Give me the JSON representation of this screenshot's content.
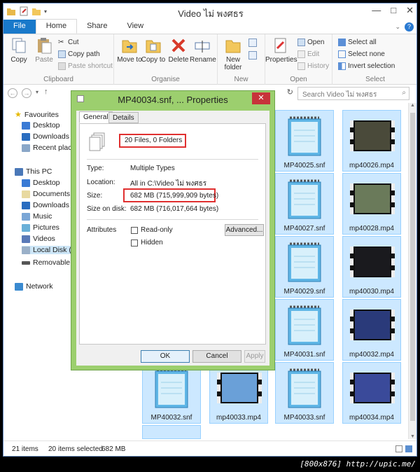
{
  "window": {
    "title": "Video ไม่ พงศธร",
    "controls": [
      "—",
      "□",
      "✕"
    ]
  },
  "ribbon_tabs": [
    "File",
    "Home",
    "Share",
    "View"
  ],
  "ribbon": {
    "clipboard": {
      "label": "Clipboard",
      "copy": "Copy",
      "paste": "Paste",
      "cut": "Cut",
      "copy_path": "Copy path",
      "paste_shortcut": "Paste shortcut"
    },
    "organise": {
      "label": "Organise",
      "move_to": "Move to",
      "copy_to": "Copy to",
      "delete": "Delete",
      "rename": "Rename"
    },
    "new": {
      "label": "New",
      "new_folder": "New folder"
    },
    "open": {
      "label": "Open",
      "properties": "Properties",
      "open": "Open",
      "edit": "Edit",
      "history": "History"
    },
    "select": {
      "label": "Select",
      "select_all": "Select all",
      "select_none": "Select none",
      "invert_selection": "Invert selection"
    }
  },
  "address": {
    "search_placeholder": "Search Video ไม่ พงศธร"
  },
  "nav": {
    "favourites": "Favourites",
    "fav_items": [
      "Desktop",
      "Downloads",
      "Recent places"
    ],
    "this_pc": "This PC",
    "pc_items": [
      "Desktop",
      "Documents",
      "Downloads",
      "Music",
      "Pictures",
      "Videos",
      "Local Disk (C:)",
      "Removable Disk"
    ],
    "network": "Network"
  },
  "files": [
    {
      "name": "MP40025.snf",
      "kind": "doc"
    },
    {
      "name": "mp40026.mp4",
      "kind": "video",
      "scene": "#4a4a3a"
    },
    {
      "name": "MP40027.snf",
      "kind": "doc"
    },
    {
      "name": "mp40028.mp4",
      "kind": "video",
      "scene": "#6a7a5a"
    },
    {
      "name": "MP40029.snf",
      "kind": "doc"
    },
    {
      "name": "mp40030.mp4",
      "kind": "video",
      "scene": "#1a1a1e"
    },
    {
      "name": "MP40031.snf",
      "kind": "doc"
    },
    {
      "name": "mp40032.mp4",
      "kind": "video",
      "scene": "#2a3a7a"
    },
    {
      "name": "MP40032.snf",
      "kind": "doc"
    },
    {
      "name": "mp40033.mp4",
      "kind": "video",
      "scene": "#6aa0d8"
    },
    {
      "name": "MP40033.snf",
      "kind": "doc"
    },
    {
      "name": "mp40034.mp4",
      "kind": "video",
      "scene": "#3a4a9a"
    }
  ],
  "status": {
    "items": "21 items",
    "selected": "20 items selected",
    "size": "682 MB"
  },
  "dialog": {
    "title": "MP40034.snf, ... Properties",
    "close": "✕",
    "tabs": [
      "General",
      "Details"
    ],
    "files_summary": "20 Files, 0 Folders",
    "type_label": "Type:",
    "type_value": "Multiple Types",
    "location_label": "Location:",
    "location_value": "All in C:\\Video ไม่ พงศธร",
    "size_label": "Size:",
    "size_value": "682 MB (715,999,909 bytes)",
    "size_on_disk_label": "Size on disk:",
    "size_on_disk_value": "682 MB (716,017,664 bytes)",
    "attributes_label": "Attributes",
    "read_only": "Read-only",
    "hidden": "Hidden",
    "advanced": "Advanced...",
    "ok": "OK",
    "cancel": "Cancel",
    "apply": "Apply"
  },
  "footer": "[800x876] http://upic.me/",
  "colors": {
    "file_tab": "#1979ca",
    "dialog_frame": "#9ccf6e",
    "highlight_box": "#e03030",
    "close_button": "#c7333a"
  }
}
